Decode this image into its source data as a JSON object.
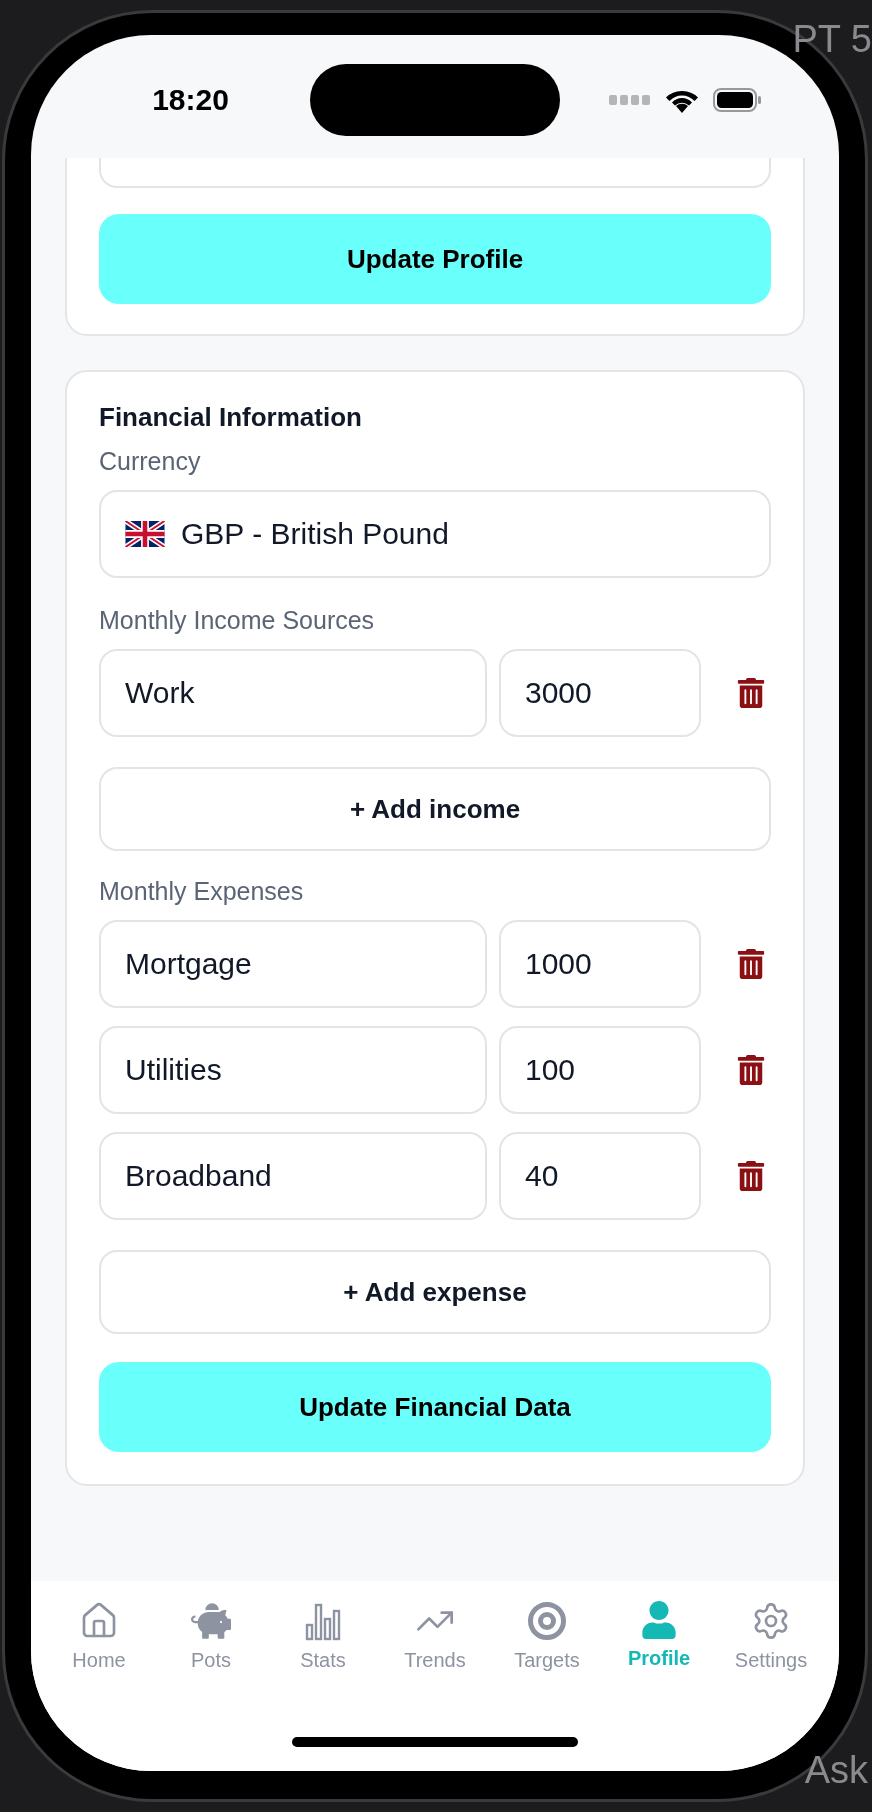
{
  "background_texts": [
    {
      "text": "PT 5",
      "kind": "top"
    },
    {
      "text": "Ask",
      "kind": "bottom"
    }
  ],
  "status_bar": {
    "time": "18:20"
  },
  "profile_card": {
    "button": "Update Profile"
  },
  "financial_card": {
    "title": "Financial Information",
    "currency_label": "Currency",
    "currency": "GBP - British Pound",
    "income_label": "Monthly Income Sources",
    "incomes": [
      {
        "name": "Work",
        "amount": "3000"
      }
    ],
    "add_income": "+ Add income",
    "expenses_label": "Monthly Expenses",
    "expenses": [
      {
        "name": "Mortgage",
        "amount": "1000"
      },
      {
        "name": "Utilities",
        "amount": "100"
      },
      {
        "name": "Broadband",
        "amount": "40"
      }
    ],
    "add_expense": "+ Add expense",
    "button": "Update Financial Data"
  },
  "tabs": [
    {
      "label": "Home",
      "kind": "home",
      "selected": false
    },
    {
      "label": "Pots",
      "kind": "pots",
      "selected": false
    },
    {
      "label": "Stats",
      "kind": "stats",
      "selected": false
    },
    {
      "label": "Trends",
      "kind": "trends",
      "selected": false
    },
    {
      "label": "Targets",
      "kind": "targets",
      "selected": false
    },
    {
      "label": "Profile",
      "kind": "profile",
      "selected": true
    },
    {
      "label": "Settings",
      "kind": "settings",
      "selected": false
    }
  ]
}
